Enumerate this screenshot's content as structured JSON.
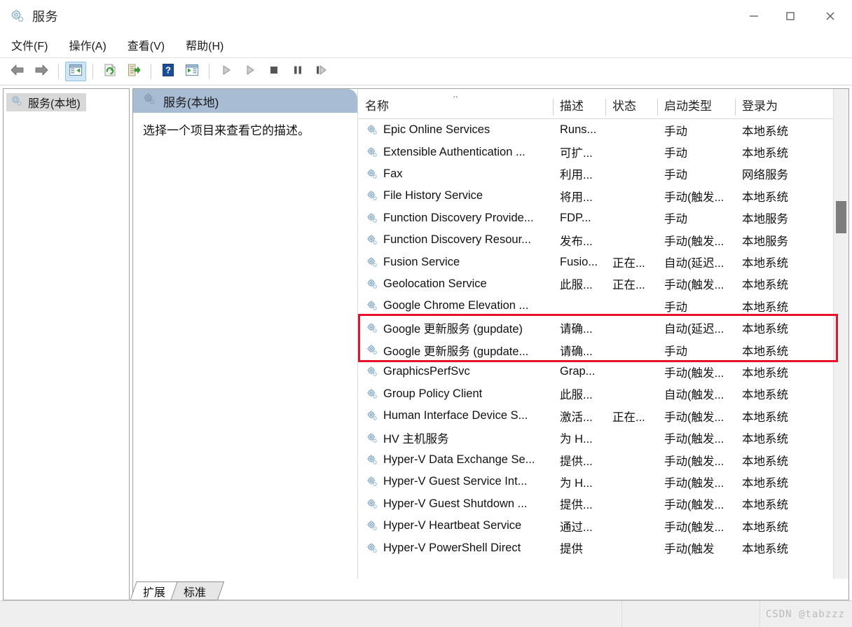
{
  "window": {
    "title": "服务",
    "icon": "services-gear-icon",
    "controls": {
      "minimize": "最小化",
      "maximize": "最大化",
      "close": "关闭"
    }
  },
  "menubar": {
    "items": [
      {
        "label": "文件(F)",
        "name": "menu-file"
      },
      {
        "label": "操作(A)",
        "name": "menu-action"
      },
      {
        "label": "查看(V)",
        "name": "menu-view"
      },
      {
        "label": "帮助(H)",
        "name": "menu-help"
      }
    ]
  },
  "toolbar": {
    "buttons": [
      {
        "name": "back-button",
        "icon": "arrow-left-icon",
        "active": false
      },
      {
        "name": "forward-button",
        "icon": "arrow-right-icon",
        "active": false
      },
      {
        "name": "show-tree-button",
        "icon": "show-console-tree-icon",
        "active": true
      },
      {
        "name": "refresh-button",
        "icon": "refresh-icon",
        "active": false
      },
      {
        "name": "export-list-button",
        "icon": "export-list-icon",
        "active": false
      },
      {
        "name": "help-button",
        "icon": "help-question-icon",
        "active": false
      },
      {
        "name": "properties-button",
        "icon": "properties-icon",
        "active": false
      },
      {
        "name": "start-service-button",
        "icon": "play-icon",
        "active": false
      },
      {
        "name": "resume-service-button",
        "icon": "play-icon",
        "active": false
      },
      {
        "name": "stop-service-button",
        "icon": "stop-icon",
        "active": false
      },
      {
        "name": "pause-service-button",
        "icon": "pause-icon",
        "active": false
      },
      {
        "name": "restart-service-button",
        "icon": "restart-icon",
        "active": false
      }
    ]
  },
  "sidebar": {
    "node": {
      "label": "服务(本地)",
      "icon": "services-gear-icon",
      "selected": true
    }
  },
  "details": {
    "header": "服务(本地)",
    "header_icon": "services-gear-icon",
    "description": "选择一个项目来查看它的描述。"
  },
  "list": {
    "columns": [
      {
        "label": "名称",
        "name": "column-name",
        "sorted": "asc"
      },
      {
        "label": "描述",
        "name": "column-description"
      },
      {
        "label": "状态",
        "name": "column-status"
      },
      {
        "label": "启动类型",
        "name": "column-startup-type"
      },
      {
        "label": "登录为",
        "name": "column-log-on-as"
      }
    ],
    "rows": [
      {
        "name": "Epic Online Services",
        "description": "Runs...",
        "status": "",
        "startup": "手动",
        "logon": "本地系统",
        "highlighted": false
      },
      {
        "name": "Extensible Authentication ...",
        "description": "可扩...",
        "status": "",
        "startup": "手动",
        "logon": "本地系统",
        "highlighted": false
      },
      {
        "name": "Fax",
        "description": "利用...",
        "status": "",
        "startup": "手动",
        "logon": "网络服务",
        "highlighted": false
      },
      {
        "name": "File History Service",
        "description": "将用...",
        "status": "",
        "startup": "手动(触发...",
        "logon": "本地系统",
        "highlighted": false
      },
      {
        "name": "Function Discovery Provide...",
        "description": "FDP...",
        "status": "",
        "startup": "手动",
        "logon": "本地服务",
        "highlighted": false
      },
      {
        "name": "Function Discovery Resour...",
        "description": "发布...",
        "status": "",
        "startup": "手动(触发...",
        "logon": "本地服务",
        "highlighted": false
      },
      {
        "name": "Fusion Service",
        "description": "Fusio...",
        "status": "正在...",
        "startup": "自动(延迟...",
        "logon": "本地系统",
        "highlighted": false
      },
      {
        "name": "Geolocation Service",
        "description": "此服...",
        "status": "正在...",
        "startup": "手动(触发...",
        "logon": "本地系统",
        "highlighted": false
      },
      {
        "name": "Google Chrome Elevation ...",
        "description": "",
        "status": "",
        "startup": "手动",
        "logon": "本地系统",
        "highlighted": false
      },
      {
        "name": "Google 更新服务 (gupdate)",
        "description": "请确...",
        "status": "",
        "startup": "自动(延迟...",
        "logon": "本地系统",
        "highlighted": true
      },
      {
        "name": "Google 更新服务 (gupdate...",
        "description": "请确...",
        "status": "",
        "startup": "手动",
        "logon": "本地系统",
        "highlighted": true
      },
      {
        "name": "GraphicsPerfSvc",
        "description": "Grap...",
        "status": "",
        "startup": "手动(触发...",
        "logon": "本地系统",
        "highlighted": false
      },
      {
        "name": "Group Policy Client",
        "description": "此服...",
        "status": "",
        "startup": "自动(触发...",
        "logon": "本地系统",
        "highlighted": false
      },
      {
        "name": "Human Interface Device S...",
        "description": "激活...",
        "status": "正在...",
        "startup": "手动(触发...",
        "logon": "本地系统",
        "highlighted": false
      },
      {
        "name": "HV 主机服务",
        "description": "为 H...",
        "status": "",
        "startup": "手动(触发...",
        "logon": "本地系统",
        "highlighted": false
      },
      {
        "name": "Hyper-V Data Exchange Se...",
        "description": "提供...",
        "status": "",
        "startup": "手动(触发...",
        "logon": "本地系统",
        "highlighted": false
      },
      {
        "name": "Hyper-V Guest Service Int...",
        "description": "为 H...",
        "status": "",
        "startup": "手动(触发...",
        "logon": "本地系统",
        "highlighted": false
      },
      {
        "name": "Hyper-V Guest Shutdown ...",
        "description": "提供...",
        "status": "",
        "startup": "手动(触发...",
        "logon": "本地系统",
        "highlighted": false
      },
      {
        "name": "Hyper-V Heartbeat Service",
        "description": "通过...",
        "status": "",
        "startup": "手动(触发...",
        "logon": "本地系统",
        "highlighted": false
      },
      {
        "name": "Hyper-V PowerShell Direct",
        "description": "提供",
        "status": "",
        "startup": "手动(触发",
        "logon": "本地系统",
        "highlighted": false
      }
    ],
    "row_icon": "service-gear-icon"
  },
  "tabs": [
    {
      "label": "扩展",
      "name": "tab-extended",
      "active": true
    },
    {
      "label": "标准",
      "name": "tab-standard",
      "active": false
    }
  ],
  "statusbar": {
    "watermark": "CSDN @tabzzz"
  },
  "colors": {
    "annotation": "#e8102a",
    "details_header": "#a8bdd4",
    "selection": "#d8d8d8",
    "toolbar_active": "#cfe6f7"
  }
}
